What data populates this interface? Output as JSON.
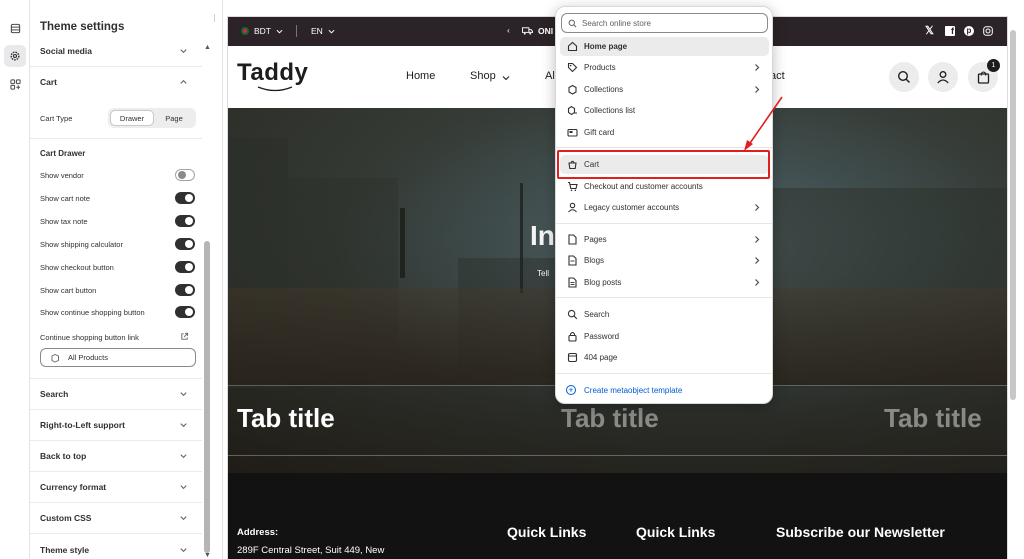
{
  "rail": {
    "items": [
      "sections-icon",
      "settings-icon",
      "apps-icon"
    ]
  },
  "panel": {
    "title": "Theme settings",
    "sections_top": {
      "social_media": "Social media",
      "cart": "Cart"
    },
    "cart_type_label": "Cart Type",
    "cart_type_options": [
      "Drawer",
      "Page"
    ],
    "cart_type_selected": "Drawer",
    "cart_drawer_title": "Cart Drawer",
    "toggles": [
      {
        "label": "Show vendor",
        "on": false
      },
      {
        "label": "Show cart note",
        "on": true
      },
      {
        "label": "Show tax note",
        "on": true
      },
      {
        "label": "Show shipping calculator",
        "on": true
      },
      {
        "label": "Show checkout button",
        "on": true
      },
      {
        "label": "Show cart button",
        "on": true
      },
      {
        "label": "Show continue shopping button",
        "on": true
      }
    ],
    "link_label": "Continue shopping button link",
    "link_value": "All Products",
    "sections_bottom": [
      "Search",
      "Right-to-Left support",
      "Back to top",
      "Currency format",
      "Custom CSS",
      "Theme style"
    ]
  },
  "store": {
    "currency": "BDT",
    "language": "EN",
    "announcement": "ONI",
    "logo": "Taddy",
    "nav": [
      "Home",
      "Shop",
      "Al",
      "act"
    ],
    "cart_count": "1",
    "hero_title_fragment": "In",
    "hero_sub_fragment": "Tell",
    "tab_titles": [
      "Tab title",
      "Tab title",
      "Tab title"
    ],
    "footer": {
      "address_label": "Address:",
      "address_line": "289F Central Street, Suit 449, New",
      "quick_links_1": "Quick Links",
      "quick_links_2": "Quick Links",
      "newsletter": "Subscribe our Newsletter"
    }
  },
  "dropdown": {
    "search_placeholder": "Search online store",
    "items": [
      {
        "label": "Home page",
        "icon": "home-icon",
        "bold": true,
        "arrow": false,
        "highlight": true
      },
      {
        "label": "Products",
        "icon": "tag-icon",
        "bold": false,
        "arrow": true,
        "highlight": false
      },
      {
        "label": "Collections",
        "icon": "collection-icon",
        "bold": false,
        "arrow": true,
        "highlight": false
      },
      {
        "label": "Collections list",
        "icon": "collection-list-icon",
        "bold": false,
        "arrow": false,
        "highlight": false
      },
      {
        "label": "Gift card",
        "icon": "gift-card-icon",
        "bold": false,
        "arrow": false,
        "highlight": false
      },
      {
        "label": "Cart",
        "icon": "cart-icon",
        "bold": false,
        "arrow": false,
        "highlight": true
      },
      {
        "label": "Checkout and customer accounts",
        "icon": "checkout-icon",
        "bold": false,
        "arrow": false,
        "highlight": false
      },
      {
        "label": "Legacy customer accounts",
        "icon": "person-icon",
        "bold": false,
        "arrow": true,
        "highlight": false
      },
      {
        "label": "Pages",
        "icon": "page-icon",
        "bold": false,
        "arrow": true,
        "highlight": false
      },
      {
        "label": "Blogs",
        "icon": "blog-icon",
        "bold": false,
        "arrow": true,
        "highlight": false
      },
      {
        "label": "Blog posts",
        "icon": "blog-post-icon",
        "bold": false,
        "arrow": true,
        "highlight": false
      },
      {
        "label": "Search",
        "icon": "search-icon",
        "bold": false,
        "arrow": false,
        "highlight": false
      },
      {
        "label": "Password",
        "icon": "lock-icon",
        "bold": false,
        "arrow": false,
        "highlight": false
      },
      {
        "label": "404 page",
        "icon": "error-page-icon",
        "bold": false,
        "arrow": false,
        "highlight": false
      }
    ],
    "create_label": "Create metaobject template"
  },
  "colors": {
    "accent_link": "#005bd3",
    "annotation_red": "#e02020",
    "topbar": "#2b2327",
    "footer": "#121212"
  }
}
